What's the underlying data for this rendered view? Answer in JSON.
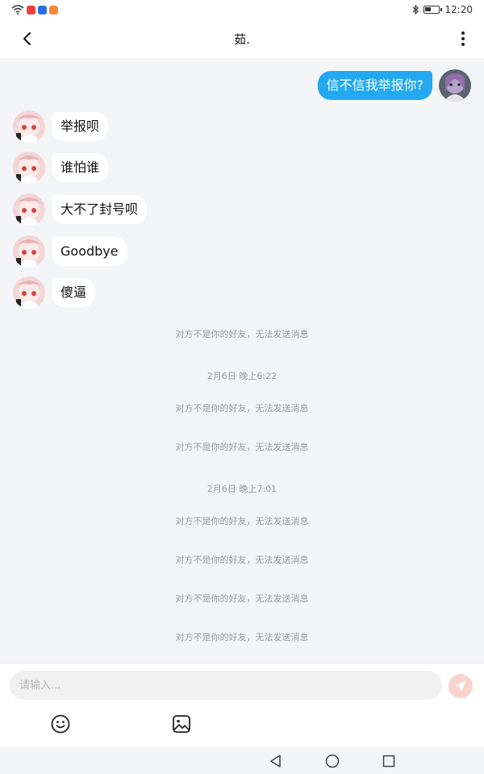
{
  "status_bar": {
    "time": "12:20",
    "left_icons": [
      "wifi-icon",
      "app-notification-red",
      "app-notification-blue",
      "app-notification-orange"
    ],
    "right_icons": [
      "bluetooth-icon",
      "battery-icon"
    ]
  },
  "header": {
    "title": "茹.",
    "back_icon": "back-arrow-icon",
    "more_icon": "more-vertical-icon"
  },
  "messages": [
    {
      "sender": "me",
      "text": "信不信我举报你?"
    },
    {
      "sender": "them",
      "text": "举报呗"
    },
    {
      "sender": "them",
      "text": "谁怕谁"
    },
    {
      "sender": "them",
      "text": "大不了封号呗"
    },
    {
      "sender": "them",
      "text": "Goodbye"
    },
    {
      "sender": "them",
      "text": "傻逼"
    }
  ],
  "system": {
    "not_friend": "对方不是你的好友，无法发送消息",
    "time1": "2月6日 晚上6:22",
    "time2": "2月6日 晚上7:01"
  },
  "input": {
    "placeholder": "请输入...",
    "value": ""
  },
  "toolbar": {
    "emoji_icon": "emoji-icon",
    "image_icon": "image-icon",
    "send_icon": "send-icon"
  },
  "navbar": {
    "icons": [
      "nav-back-icon",
      "nav-home-icon",
      "nav-recents-icon"
    ]
  },
  "colors": {
    "my_bubble": "#23a9f2",
    "their_bubble": "#ffffff",
    "background": "#f4f5f7",
    "send_button": "#fbd3cc"
  }
}
